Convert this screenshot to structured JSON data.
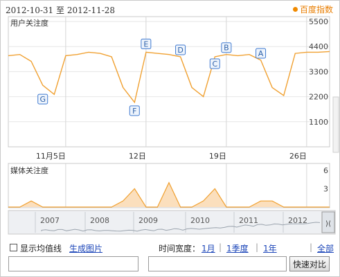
{
  "header": {
    "date_start": "2012-10-31",
    "date_sep": "至",
    "date_end": "2012-11-28",
    "brand_label": "百度指数"
  },
  "main_chart": {
    "label": "用户关注度",
    "y_ticks": [
      "5500",
      "4400",
      "3300",
      "2200",
      "1100"
    ],
    "y_tick_values": [
      5500,
      4400,
      3300,
      2200,
      1100
    ],
    "x_ticks": [
      "11月5日",
      "12日",
      "19日",
      "26日"
    ],
    "markers": [
      "G",
      "F",
      "E",
      "D",
      "C",
      "B",
      "A"
    ]
  },
  "media_chart": {
    "label": "媒体关注度",
    "y_ticks": [
      "6",
      "3"
    ]
  },
  "timeline": {
    "years": [
      "2007",
      "2008",
      "2009",
      "2010",
      "2011",
      "2012"
    ]
  },
  "controls": {
    "show_average_label": "显示均值线",
    "generate_image_label": "生成图片",
    "time_span_label": "时间宽度：",
    "span_1m": "1月",
    "span_q": "1季度",
    "span_y": "1年",
    "span_all": "全部",
    "separator": "|",
    "compare_button": "快速对比"
  },
  "chart_data": {
    "type": "line",
    "title": "用户关注度",
    "x": [
      "10-31",
      "11-01",
      "11-02",
      "11-03",
      "11-04",
      "11-05",
      "11-06",
      "11-07",
      "11-08",
      "11-09",
      "11-10",
      "11-11",
      "11-12",
      "11-13",
      "11-14",
      "11-15",
      "11-16",
      "11-17",
      "11-18",
      "11-19",
      "11-20",
      "11-21",
      "11-22",
      "11-23",
      "11-24",
      "11-25",
      "11-26",
      "11-27",
      "11-28"
    ],
    "series": [
      {
        "values": [
          4000,
          4050,
          3750,
          2700,
          2300,
          4000,
          4050,
          4150,
          4100,
          3950,
          2600,
          1950,
          4150,
          4100,
          4050,
          3950,
          2600,
          2200,
          3950,
          4050,
          4000,
          4050,
          3800,
          2600,
          2250,
          4100,
          4150,
          4150,
          4180
        ]
      }
    ],
    "ylim": [
      0,
      5500
    ],
    "colors": {
      "line": "#f0a030",
      "marker_border": "#3f7ad0"
    },
    "markers": [
      {
        "label": "G",
        "date": "11-03"
      },
      {
        "label": "F",
        "date": "11-11"
      },
      {
        "label": "E",
        "date": "11-12"
      },
      {
        "label": "D",
        "date": "11-15"
      },
      {
        "label": "C",
        "date": "11-18"
      },
      {
        "label": "B",
        "date": "11-19"
      },
      {
        "label": "A",
        "date": "11-22"
      }
    ],
    "media_series": {
      "values": [
        0,
        0,
        1,
        0,
        0,
        0,
        0,
        0,
        0,
        0,
        1,
        3,
        0,
        0,
        4,
        0,
        0,
        1,
        3,
        0,
        0,
        0,
        1,
        1,
        0,
        0,
        0,
        0,
        0
      ],
      "ylim": [
        0,
        6
      ]
    }
  }
}
